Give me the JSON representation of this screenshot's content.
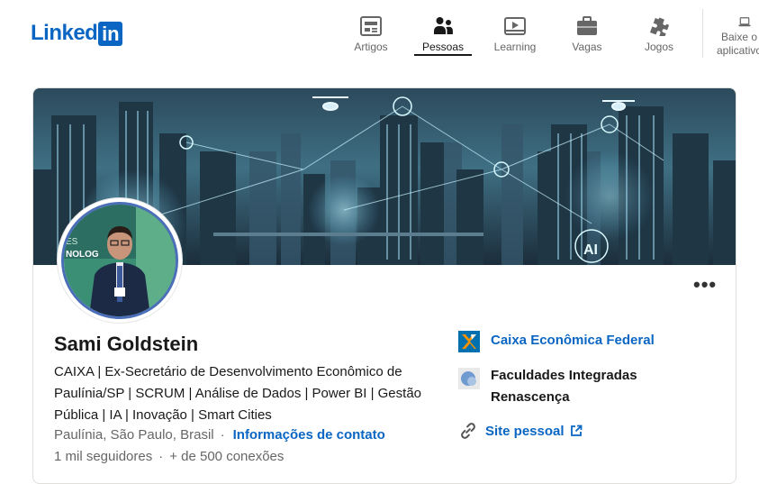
{
  "brand": {
    "logo_word": "Linked",
    "logo_box": "in"
  },
  "nav": {
    "items": [
      {
        "label": "Artigos",
        "icon": "articles-icon"
      },
      {
        "label": "Pessoas",
        "icon": "people-icon",
        "active": true
      },
      {
        "label": "Learning",
        "icon": "learning-icon"
      },
      {
        "label": "Vagas",
        "icon": "jobs-icon"
      },
      {
        "label": "Jogos",
        "icon": "games-icon"
      }
    ],
    "download_label_line1": "Baixe o",
    "download_label_line2": "aplicativo"
  },
  "banner_badge": "AI",
  "avatar_text": "ES\nNOLOG",
  "profile": {
    "name": "Sami Goldstein",
    "headline": "CAIXA | Ex-Secretário de Desenvolvimento Econômico de Paulínia/SP | SCRUM | Análise de Dados | Power BI | Gestão Pública | IA | Inovação | Smart Cities",
    "location": "Paulínia, São Paulo, Brasil",
    "contact_link": "Informações de contato",
    "followers": "1 mil seguidores",
    "connections": "+ de 500 conexões",
    "more_label": "•••"
  },
  "orgs": {
    "company": "Caixa Econômica Federal",
    "education": "Faculdades Integradas Renascença",
    "site": "Site pessoal"
  },
  "colors": {
    "brand_blue": "#0a66c2",
    "caixa_blue": "#0070af",
    "caixa_orange": "#f39200"
  }
}
